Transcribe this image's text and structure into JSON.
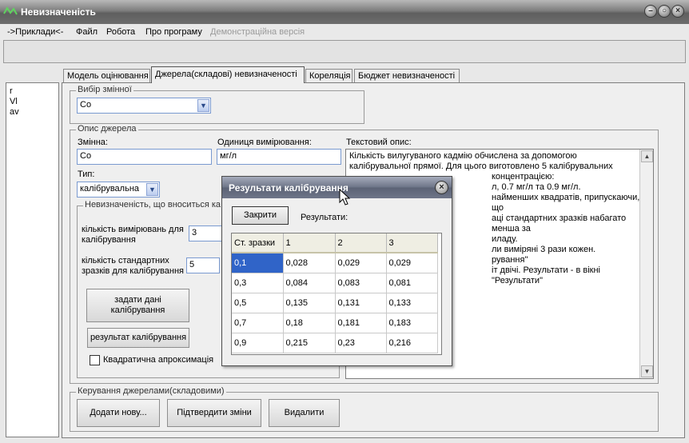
{
  "window": {
    "title": "Невизначеність"
  },
  "menu": {
    "items": [
      "->Приклади<-",
      "Файл",
      "Робота",
      "Про програму"
    ],
    "disabled_item": "Демонстраційна версія"
  },
  "left_list": [
    "r",
    "Vl",
    "av"
  ],
  "tabs": [
    "Модель оцінювання",
    "Джерела(складові) невизначеності",
    "Кореляція",
    "Бюджет невизначеності"
  ],
  "variable_select": {
    "legend": "Вибір змінної",
    "value": "Co"
  },
  "source": {
    "legend": "Опис джерела",
    "variable_label": "Змінна:",
    "variable_value": "Co",
    "unit_label": "Одиниця вимірювання:",
    "unit_value": "мг/л",
    "text_label": "Текстовий опис:",
    "type_label": "Тип:",
    "type_value": "калібрувальна",
    "description_lines": [
      "Кількість вилугуваного кадмію обчислена за допомогою",
      "калібрувальної прямої. Для цього виготовлено 5 калібрувальних",
      "концентрацією:",
      "л, 0.7 мг/л та 0.9 мг/л.",
      "найменших квадратів, припускаючи, що",
      "аці стандартних зразків набагато менша за",
      "иладу.",
      "ли виміряні 3 рази кожен.",
      "рування\"",
      "іт двічі. Результати  - в вікні \"Результати\""
    ]
  },
  "uncertainty": {
    "legend": "Невизначеність, що вноситься ка",
    "measurements_label": "кількість вимірювань для калібрування",
    "measurements_value": "3",
    "standards_label": "кількість стандартних зразків для калібрування",
    "standards_value": "5",
    "set_data_button": "задати дані калібрування",
    "result_button": "результат калібрування",
    "quadratic_label": "Квадратична апроксимація"
  },
  "management": {
    "legend": "Керування джерелами(складовими)",
    "add_button": "Додати нову...",
    "confirm_button": "Підтвердити зміни",
    "delete_button": "Видалити"
  },
  "dialog": {
    "title": "Результати калібрування",
    "close_button": "Закрити",
    "results_label": "Результати:",
    "columns": [
      "Ст. зразки",
      "1",
      "2",
      "3"
    ],
    "rows": [
      [
        "0,1",
        "0,028",
        "0,029",
        "0,029"
      ],
      [
        "0,3",
        "0,084",
        "0,083",
        "0,081"
      ],
      [
        "0,5",
        "0,135",
        "0,131",
        "0,133"
      ],
      [
        "0,7",
        "0,18",
        "0,181",
        "0,183"
      ],
      [
        "0,9",
        "0,215",
        "0,23",
        "0,216"
      ]
    ]
  }
}
